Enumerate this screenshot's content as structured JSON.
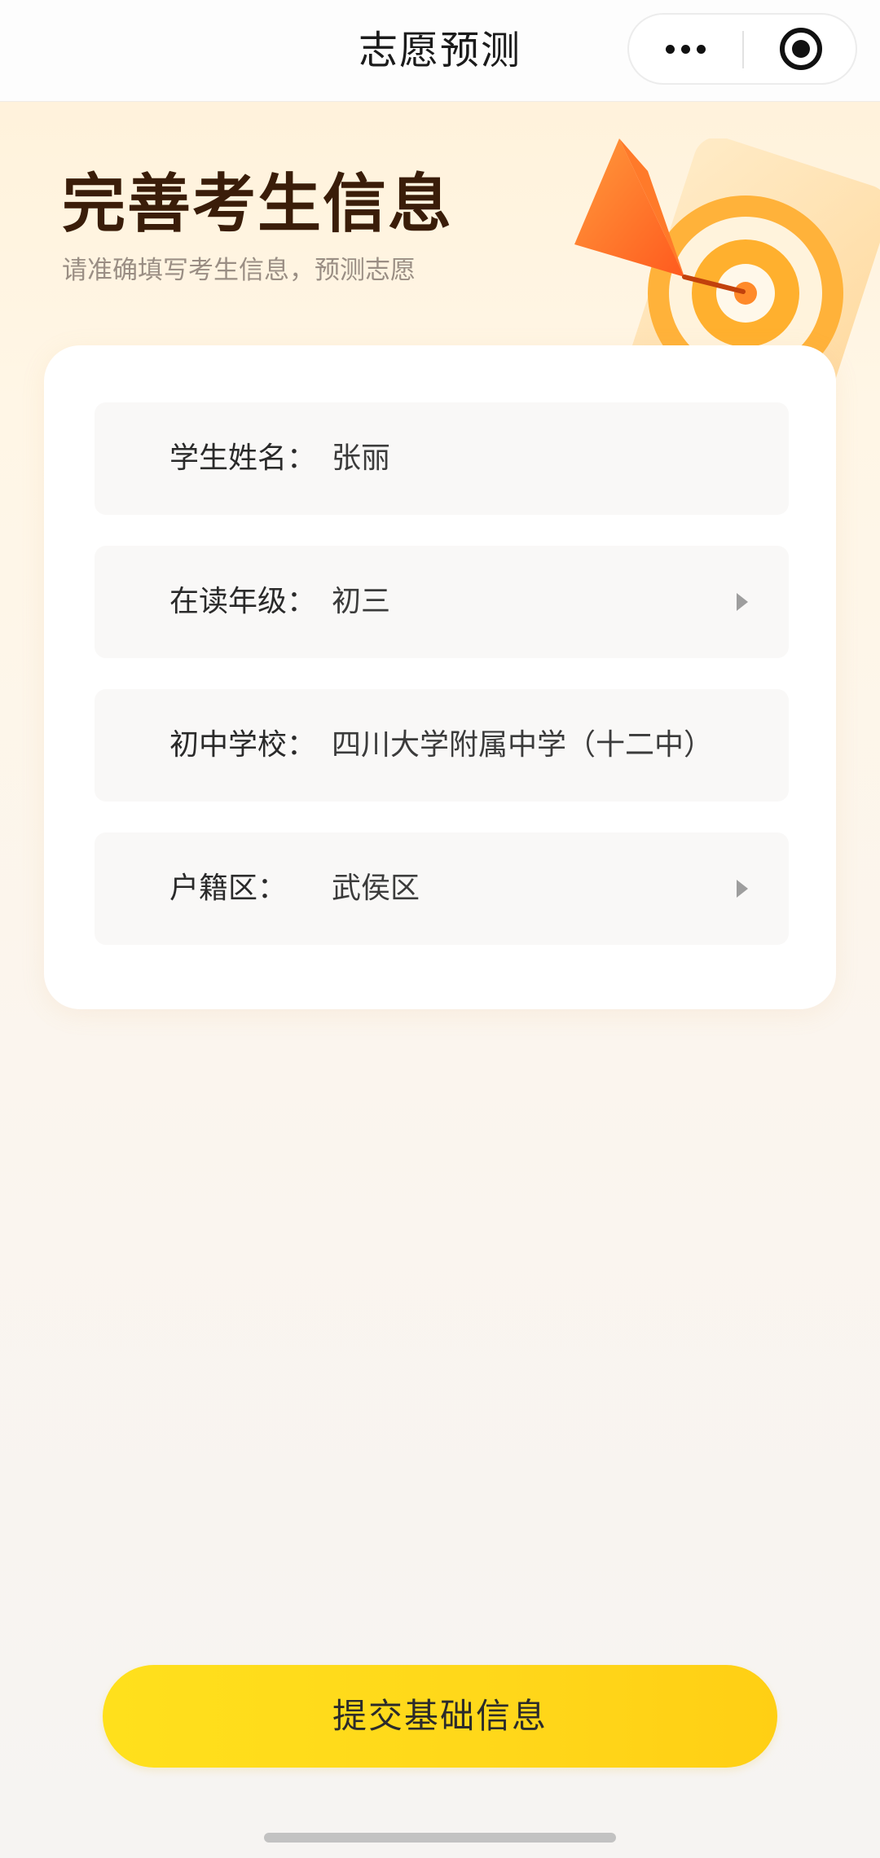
{
  "nav": {
    "title": "志愿预测",
    "more_icon": "more-dots-icon",
    "close_icon": "target-close-icon"
  },
  "header": {
    "title": "完善考生信息",
    "subtitle": "请准确填写考生信息，预测志愿"
  },
  "form": {
    "fields": [
      {
        "label": "学生姓名：",
        "value": "张丽",
        "has_arrow": false
      },
      {
        "label": "在读年级：",
        "value": "初三",
        "has_arrow": true
      },
      {
        "label": "初中学校：",
        "value": "四川大学附属中学（十二中）",
        "has_arrow": false
      },
      {
        "label": "户籍区：",
        "value": "武侯区",
        "has_arrow": true
      }
    ]
  },
  "submit_label": "提交基础信息",
  "colors": {
    "accent": "#ffd91a",
    "title": "#3a1d09",
    "background": "#fff4e2"
  }
}
